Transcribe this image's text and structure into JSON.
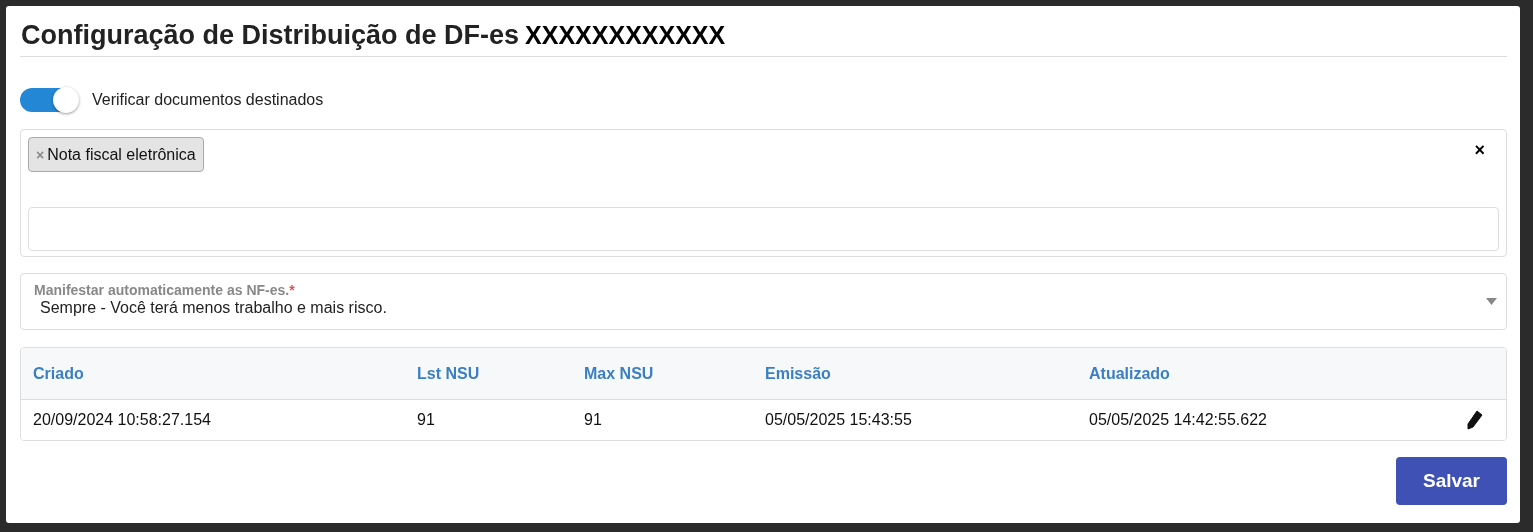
{
  "title": "Configuração de Distribuição de DF-es",
  "title_suffix": "XXXXXXXXXXXX",
  "toggle": {
    "label": "Verificar documentos destinados",
    "on": true
  },
  "multiselect": {
    "chips": [
      {
        "remove": "×",
        "label": "Nota fiscal eletrônica"
      }
    ],
    "clear": "×"
  },
  "select": {
    "label": "Manifestar automaticamente as NF-es.",
    "required": true,
    "required_mark": "*",
    "value": "Sempre - Você terá menos trabalho e mais risco."
  },
  "table": {
    "columns": [
      "Criado",
      "Lst NSU",
      "Max NSU",
      "Emissão",
      "Atualizado"
    ],
    "rows": [
      {
        "cells": [
          "20/09/2024 10:58:27.154",
          "91",
          "91",
          "05/05/2025 15:43:55",
          "05/05/2025 14:42:55.622"
        ]
      }
    ]
  },
  "save_button": "Salvar"
}
